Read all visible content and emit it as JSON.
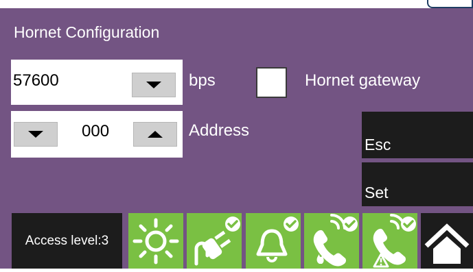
{
  "title": "Hornet Configuration",
  "baud": {
    "value": "57600",
    "unit": "bps"
  },
  "gateway": {
    "label": "Hornet gateway",
    "checked": false
  },
  "address": {
    "value": "000",
    "label": "Address"
  },
  "buttons": {
    "esc": "Esc",
    "set": "Set"
  },
  "status": {
    "access_level": "Access level:3"
  },
  "status_icons": [
    "sun-icon",
    "power-plug-check-icon",
    "bell-check-icon",
    "phone-fire-check-icon",
    "phone-warning-check-icon",
    "home-icon"
  ],
  "colors": {
    "background": "#735483",
    "status_green": "#7ac043",
    "dark_panel": "#1c1c1c"
  }
}
